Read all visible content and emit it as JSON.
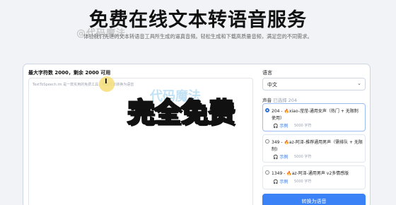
{
  "hero": {
    "title": "免费在线文本转语音服务",
    "watermark": "@代码魔法",
    "subtitle": "体验我们先进的文本转语音工具所生成的逼真音频。轻松生成和下载高质量音频，满足您的不同需求。"
  },
  "editor": {
    "char_limit": "最大字符数 2000，剩余 2000 可用",
    "placeholder": "TextToSpeech.im 是一款实用的免费工具，可将文本转换为语音"
  },
  "language": {
    "label": "语言",
    "selected": "中文"
  },
  "voice": {
    "label": "声音",
    "selected_prefix": "已选择 204",
    "items": [
      {
        "id": "204",
        "name": "xiao-滢滢-通用女声（热门 + 无限制使用）",
        "line1": "204 - ",
        "line1b": "xiao-滢滢-通用女声（热门 + 无限制",
        "line2": "使用）",
        "example": "示例",
        "count": "5000 字符",
        "active": true
      },
      {
        "id": "349",
        "line1": "349 - ",
        "line1b": "az-阿泽-推荐通用男声（需排队 + 无限",
        "line2": "制)",
        "example": "示例",
        "count": "5000 字符",
        "active": false
      },
      {
        "id": "1349",
        "line1": "1349 - ",
        "line1b": "az-阿泽-通用男声 v2多情感版",
        "line2": "",
        "example": "示例",
        "count": "5000 字符",
        "active": false
      }
    ]
  },
  "convert_button": "转换为语音",
  "overlay_text": "完全免费",
  "overlay_logo": "代码魔法",
  "colors": {
    "accent": "#3b82f6",
    "overlay_fill": "#f7e84a",
    "overlay_stroke": "#111111"
  },
  "icons": {
    "flame": "flame-icon",
    "headphones": "headphones-icon",
    "chevron": "chevron-down-icon",
    "cursor": "text-cursor-icon"
  }
}
